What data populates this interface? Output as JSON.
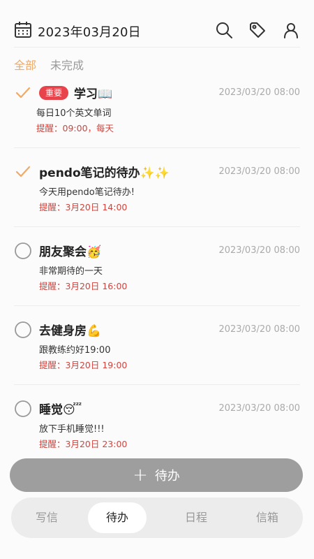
{
  "header": {
    "date": "2023年03月20日",
    "icons": [
      "calendar-icon",
      "search-icon",
      "tag-icon",
      "user-icon"
    ]
  },
  "filters": [
    {
      "label": "全部",
      "active": true
    },
    {
      "label": "未完成",
      "active": false
    }
  ],
  "todos": [
    {
      "title": "学习📖",
      "badge": "重要",
      "time": "2023/03/20 08:00",
      "desc": "每日10个英文单词",
      "reminder": "提醒：09:00，每天",
      "done": true
    },
    {
      "title": "pendo笔记的待办✨✨",
      "badge": "",
      "time": "2023/03/20 08:00",
      "desc": "今天用pendo笔记待办!",
      "reminder": "提醒：3月20日 14:00",
      "done": true
    },
    {
      "title": "朋友聚会🥳",
      "badge": "",
      "time": "2023/03/20 08:00",
      "desc": "非常期待的一天",
      "reminder": "提醒：3月20日 16:00",
      "done": false
    },
    {
      "title": "去健身房💪",
      "badge": "",
      "time": "2023/03/20 08:00",
      "desc": "跟教练约好19:00",
      "reminder": "提醒：3月20日 19:00",
      "done": false
    },
    {
      "title": "睡觉😴",
      "badge": "",
      "time": "2023/03/20 08:00",
      "desc": "放下手机睡觉!!!",
      "reminder": "提醒：3月20日 23:00",
      "done": false
    }
  ],
  "add_button": {
    "label": "待办"
  },
  "bottom_nav": [
    {
      "label": "写信",
      "active": false
    },
    {
      "label": "待办",
      "active": true
    },
    {
      "label": "日程",
      "active": false
    },
    {
      "label": "信箱",
      "active": false
    }
  ],
  "colors": {
    "accent": "#f0a967",
    "badge": "#e8434a",
    "reminder": "#d2443e",
    "add_button": "#9e9e9e"
  }
}
